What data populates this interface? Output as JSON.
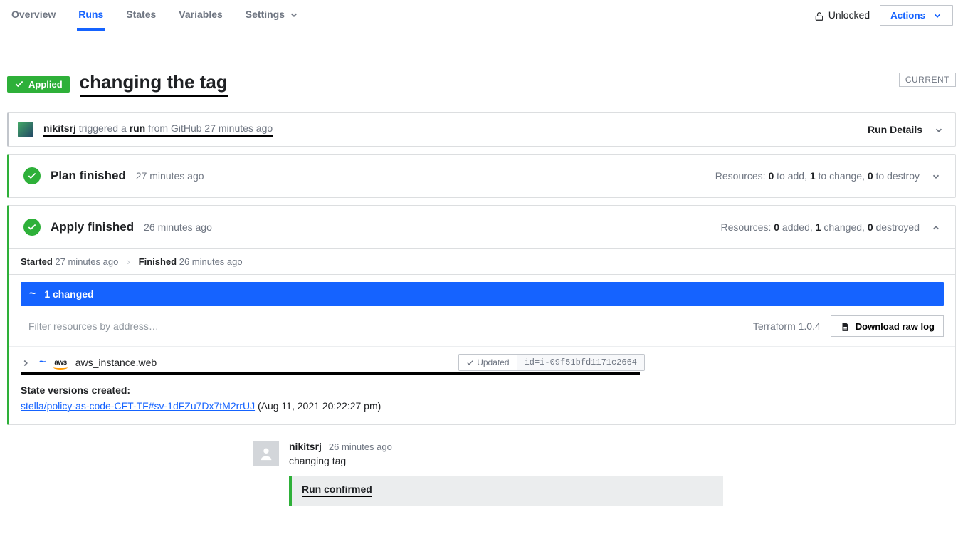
{
  "tabs": {
    "overview": "Overview",
    "runs": "Runs",
    "states": "States",
    "variables": "Variables",
    "settings": "Settings"
  },
  "lock": {
    "label": "Unlocked"
  },
  "actions_label": "Actions",
  "status_badge": "Applied",
  "run_title": "changing the tag",
  "current_label": "CURRENT",
  "trigger": {
    "user": "nikitsrj",
    "verb": " triggered a ",
    "noun": "run",
    "suffix": " from GitHub 27 minutes ago",
    "details_label": "Run Details"
  },
  "plan": {
    "title": "Plan finished",
    "time": "27 minutes ago",
    "resources_prefix": "Resources: ",
    "add_n": "0",
    "add_t": " to add, ",
    "change_n": "1",
    "change_t": " to change, ",
    "destroy_n": "0",
    "destroy_t": " to destroy"
  },
  "apply": {
    "title": "Apply finished",
    "time": "26 minutes ago",
    "resources_prefix": "Resources: ",
    "added_n": "0",
    "added_t": " added, ",
    "changed_n": "1",
    "changed_t": " changed, ",
    "destroyed_n": "0",
    "destroyed_t": " destroyed",
    "started_label": "Started",
    "started_time": " 27 minutes ago",
    "finished_label": "Finished",
    "finished_time": " 26 minutes ago",
    "changed_bar": "1 changed",
    "filter_placeholder": "Filter resources by address…",
    "tf_version": "Terraform 1.0.4",
    "download_label": "Download raw log",
    "resource": {
      "name": "aws_instance.web",
      "status": "Updated",
      "id": "id=i-09f51bfd1171c2664"
    },
    "state_heading": "State versions created:",
    "state_link": "stella/policy-as-code-CFT-TF#sv-1dFZu7Dx7tM2rrUJ",
    "state_ts": " (Aug 11, 2021 20:22:27 pm)"
  },
  "comment": {
    "user": "nikitsrj",
    "time": "26 minutes ago",
    "message": "changing tag",
    "confirmed": "Run confirmed"
  }
}
